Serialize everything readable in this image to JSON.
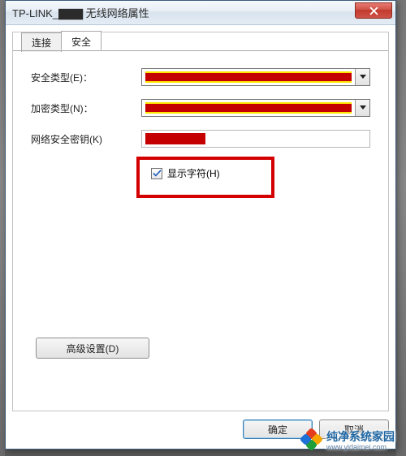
{
  "window": {
    "title": "TP-LINK_▇▇▇ 无线网络属性"
  },
  "tabs": {
    "connect": "连接",
    "security": "安全"
  },
  "form": {
    "security_type_label": "安全类型(E)：",
    "encryption_type_label": "加密类型(N)：",
    "key_label": "网络安全密钥(K)",
    "show_chars_label": "显示字符(H)"
  },
  "buttons": {
    "advanced": "高级设置(D)",
    "ok": "确定",
    "cancel": "取消"
  },
  "watermark": {
    "brand": "纯净系统家园",
    "url": "www.yidaimei.com"
  }
}
